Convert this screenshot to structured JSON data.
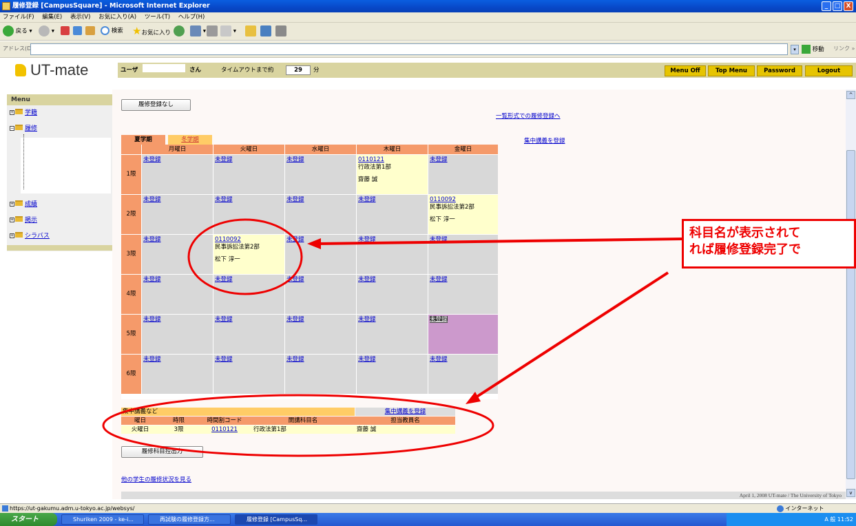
{
  "window": {
    "title": "履修登録 [CampusSquare] - Microsoft Internet Explorer",
    "min": "_",
    "max": "□",
    "close": "X"
  },
  "menubar": [
    "ファイル(F)",
    "編集(E)",
    "表示(V)",
    "お気に入り(A)",
    "ツール(T)",
    "ヘルプ(H)"
  ],
  "toolbar": {
    "back": "戻る",
    "search": "検索",
    "favorites": "お気に入り"
  },
  "address": {
    "label": "アドレス(D)",
    "go": "移動",
    "links": "リンク »"
  },
  "app": {
    "logo": "UT-mate",
    "user_label": "ユーザ",
    "user_suffix": "さん",
    "timeout_label": "タイムアウトまで約",
    "timeout_value": "29",
    "timeout_unit": "分",
    "buttons": {
      "menu_off": "Menu Off",
      "top_menu": "Top Menu",
      "password": "Password",
      "logout": "Logout"
    }
  },
  "sidebar": {
    "title": "Menu",
    "items": [
      {
        "label": "学籍"
      },
      {
        "label": "履修"
      },
      {
        "label": "成績"
      },
      {
        "label": "掲示"
      },
      {
        "label": "シラバス"
      }
    ]
  },
  "main": {
    "no_registration_button": "履修登録なし",
    "list_form_link": "一覧形式での履修登録へ",
    "intensive_register_link": "集中講義を登録",
    "tabs": [
      {
        "label": "夏学期",
        "active": true
      },
      {
        "label": "冬学期",
        "active": false
      }
    ],
    "days": [
      "月曜日",
      "火曜日",
      "水曜日",
      "木曜日",
      "金曜日"
    ],
    "periods": [
      "1限",
      "2限",
      "3限",
      "4限",
      "5限",
      "6限"
    ],
    "unregistered": "未登録",
    "timetable": [
      [
        {
          "status": "未登録"
        },
        {
          "status": "未登録"
        },
        {
          "status": "未登録"
        },
        {
          "code": "0110121",
          "name": "行政法第1部",
          "teacher": "齋藤 誠"
        },
        {
          "status": "未登録"
        }
      ],
      [
        {
          "status": "未登録"
        },
        {
          "status": "未登録"
        },
        {
          "status": "未登録"
        },
        {
          "status": "未登録"
        },
        {
          "code": "0110092",
          "name": "民事訴訟法第2部",
          "teacher": "松下 淳一"
        }
      ],
      [
        {
          "status": "未登録"
        },
        {
          "code": "0110092",
          "name": "民事訴訟法第2部",
          "teacher": "松下 淳一"
        },
        {
          "status": "未登録"
        },
        {
          "status": "未登録"
        },
        {
          "status": "未登録"
        }
      ],
      [
        {
          "status": "未登録"
        },
        {
          "status": "未登録"
        },
        {
          "status": "未登録"
        },
        {
          "status": "未登録"
        },
        {
          "status": "未登録"
        }
      ],
      [
        {
          "status": "未登録"
        },
        {
          "status": "未登録"
        },
        {
          "status": "未登録"
        },
        {
          "status": "未登録"
        },
        {
          "status": "未登録",
          "selected": true
        }
      ],
      [
        {
          "status": "未登録"
        },
        {
          "status": "未登録"
        },
        {
          "status": "未登録"
        },
        {
          "status": "未登録"
        },
        {
          "status": "未登録"
        }
      ]
    ],
    "intensive": {
      "title": "集中講義など",
      "register_link": "集中講義を登録",
      "headers": [
        "曜日",
        "時限",
        "時間割コード",
        "開講科目名",
        "担当教員名"
      ],
      "rows": [
        [
          "火曜日",
          "3限",
          "0110121",
          "行政法第1部",
          "齋藤 誠"
        ]
      ]
    },
    "export_button": "履修科目控出力",
    "others_link": "他の学生の履修状況を見る",
    "footer": "April 1, 2008 UT-mate / The University of Tokyo"
  },
  "callout": {
    "line1": "科目名が表示されて",
    "line2": "れば履修登録完了で"
  },
  "statusbar": {
    "url": "https://ut-gakumu.adm.u-tokyo.ac.jp/websys/",
    "zone": "インターネット"
  },
  "taskbar": {
    "start": "スタート",
    "tasks": [
      "Shuriken 2009 - ke-i...",
      "再試験の履修登録方...",
      "履修登録 [CampusSq..."
    ],
    "tray": "A 般 11:52"
  },
  "colors": {
    "header_bar": "#d9d4a0",
    "button_yellow": "#e6c400",
    "grid_header": "#f59a6a",
    "registered": "#ffffcc",
    "empty": "#d8d8d8",
    "annotation": "#e00000"
  }
}
